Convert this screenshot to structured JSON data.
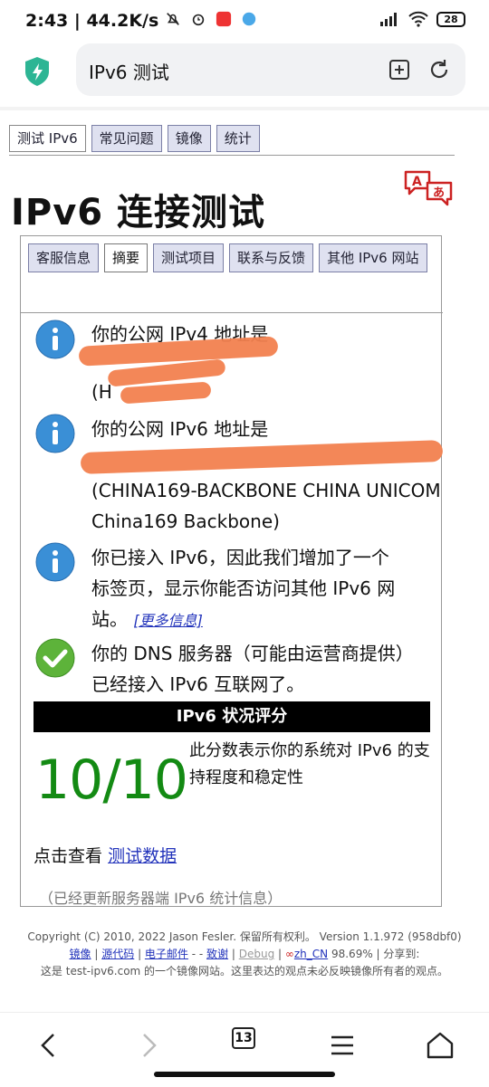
{
  "status_bar": {
    "time": "2:43",
    "speed": "44.2K/s",
    "battery": "28"
  },
  "address_bar": {
    "text": "IPv6 测试"
  },
  "top_tabs": [
    "测试 IPv6",
    "常见问题",
    "镜像",
    "统计"
  ],
  "page_title": "IPv6 连接测试",
  "sub_tabs": [
    "客服信息",
    "摘要",
    "测试项目",
    "联系与反馈",
    "其他 IPv6 网站"
  ],
  "info": {
    "ipv4_label": "你的公网 IPv4 地址是",
    "ipv4_partial": "(H",
    "ipv6_label": "你的公网 IPv6 地址是",
    "ipv6_isp": "(CHINA169-BACKBONE CHINA UNICOM China169 Backbone)",
    "ipv6_tab_msg": "你已接入 IPv6，因此我们增加了一个标签页，显示你能否访问其他 IPv6 网站。",
    "more_info": "[更多信息]",
    "dns_msg": "你的 DNS 服务器（可能由运营商提供）已经接入 IPv6 互联网了。"
  },
  "score": {
    "header": "IPv6 状况评分",
    "value": "10/10",
    "description": "此分数表示你的系统对 IPv6 的支持程度和稳定性"
  },
  "click_prefix": "点击查看",
  "click_link": "测试数据",
  "updated_note": "（已经更新服务器端 IPv6 统计信息）",
  "footer": {
    "copyright": "Copyright (C) 2010, 2022 Jason Fesler. 保留所有权利。 Version 1.1.972 (958dbf0)",
    "links": [
      "镜像",
      "源代码",
      "电子邮件",
      "致谢",
      "Debug",
      "zh_CN"
    ],
    "mid_text": "98.69% | 分享到:",
    "mirror_note": "这是 test-ipv6.com 的一个镜像网站。这里表达的观点未必反映镜像所有者的观点。"
  },
  "bottom_nav": {
    "tab_count": "13"
  },
  "colors": {
    "score_green": "#138a13",
    "tab_bg": "#dfe1f0",
    "info_blue": "#3a8fd6",
    "ok_green": "#5db33a",
    "redact": "#f2814f"
  }
}
